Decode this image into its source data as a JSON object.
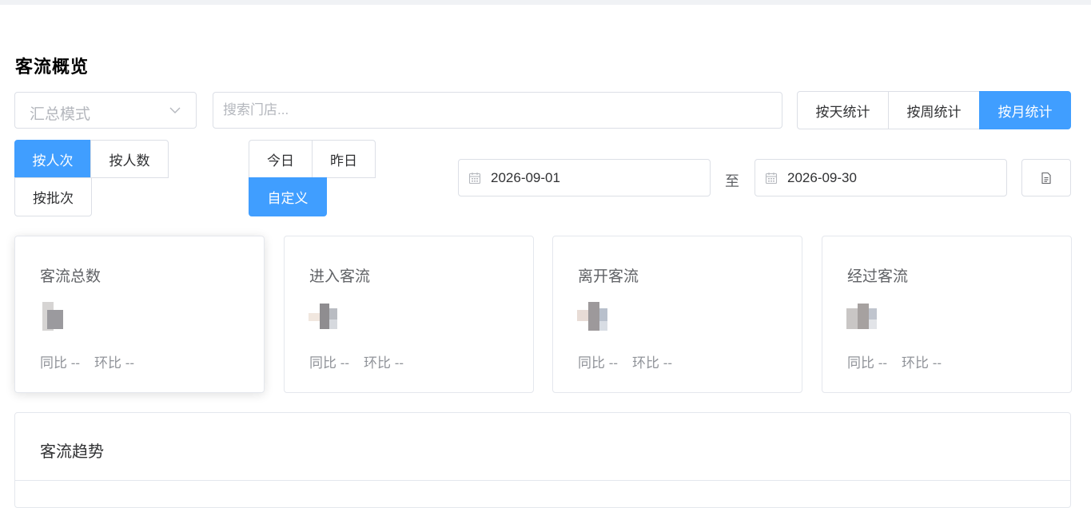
{
  "page": {
    "title": "客流概览"
  },
  "filters": {
    "mode_select": {
      "value": "汇总模式"
    },
    "search": {
      "placeholder": "搜索门店..."
    },
    "stat_period": [
      "按天统计",
      "按周统计",
      "按月统计"
    ],
    "stat_period_active": "按月统计",
    "count_type": [
      "按人次",
      "按人数",
      "按批次"
    ],
    "count_type_active": "按人次",
    "quick_range": [
      "今日",
      "昨日",
      "自定义"
    ],
    "quick_range_active": "自定义",
    "date_start": "2026-09-01",
    "date_sep": "至",
    "date_end": "2026-09-30"
  },
  "cards": [
    {
      "label": "客流总数",
      "yoy": "同比 --",
      "mom": "环比 --"
    },
    {
      "label": "进入客流",
      "yoy": "同比 --",
      "mom": "环比 --"
    },
    {
      "label": "离开客流",
      "yoy": "同比 --",
      "mom": "环比 --"
    },
    {
      "label": "经过客流",
      "yoy": "同比 --",
      "mom": "环比 --"
    }
  ],
  "trend": {
    "title": "客流趋势"
  },
  "colors": {
    "primary": "#409eff",
    "border": "#dcdfe6",
    "muted": "#909399"
  },
  "icons": [
    "chevron-down-icon",
    "calendar-icon",
    "document-icon"
  ]
}
